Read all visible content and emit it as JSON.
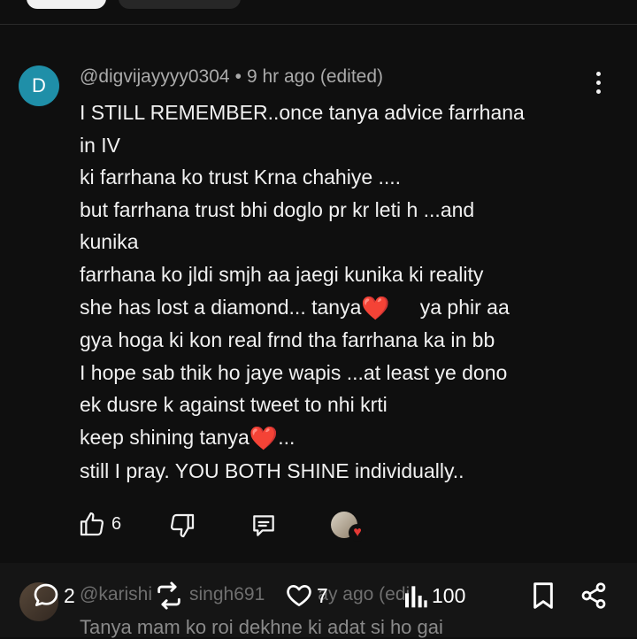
{
  "comment": {
    "avatar_letter": "D",
    "username": "@digvijayyyy0304",
    "separator": "•",
    "time": "9 hr ago (edited)",
    "lines": [
      "I STILL REMEMBER..once tanya advice farrhana",
      "in IV",
      "ki farrhana ko trust Krna chahiye ....",
      "but farrhana trust bhi doglo pr kr leti h ...and",
      "kunika",
      "farrhana ko jldi smjh aa jaegi kunika ki reality",
      "she has lost a diamond... tanya",
      "ya phir aa",
      "gya hoga ki kon real frnd tha farrhana ka in bb",
      "I hope sab thik ho jaye wapis ...at least ye dono",
      "ek dusre k against tweet to nhi krti",
      "keep shining tanya",
      "...",
      "still I pray. YOU BOTH SHINE individually.."
    ],
    "heart_emoji": "❤️",
    "like_count": "6"
  },
  "next_comment": {
    "username_partial": "@karishi",
    "username_partial_2": "singh691",
    "time_partial": "ay ago (edi",
    "text_partial": "Tanya mam ko roi dekhne ki adat si ho gai"
  },
  "bottom_bar": {
    "replies": "2",
    "likes": "7",
    "views": "100"
  },
  "icons": {
    "like": "thumbs-up-icon",
    "dislike": "thumbs-down-icon",
    "reply": "reply-icon",
    "more": "more-vertical-icon",
    "bookmark": "bookmark-icon",
    "share": "share-icon"
  },
  "colors": {
    "background": "#0f0f0f",
    "avatar": "#1f8fa8",
    "heart": "#e53935",
    "muted_text": "#aaaaaa"
  }
}
